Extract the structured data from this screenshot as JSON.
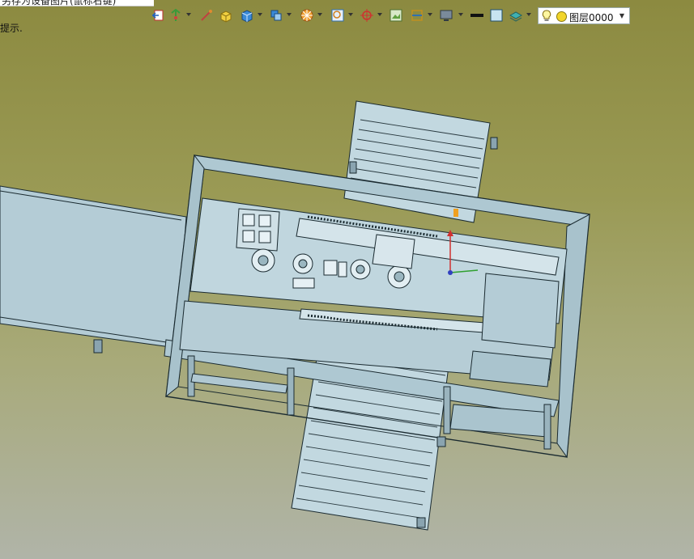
{
  "window": {
    "title_fragment": "另存为设备图片(鼠标右键)"
  },
  "prompt": {
    "text": "提示."
  },
  "toolbar": {
    "icons": [
      "exit-sketch-icon",
      "smart-dimension-icon",
      "line-tool-icon",
      "box-primitive-icon",
      "cube-primitive-icon",
      "solid-view-icon",
      "wheel-icon",
      "zoom-fit-icon",
      "crosshair-icon",
      "image-icon",
      "section-view-icon",
      "monitor-icon",
      "line-style-icon",
      "fill-color-icon",
      "layers-stack-icon"
    ],
    "layer": {
      "name": "图层0000",
      "color": "#f2d52a"
    }
  },
  "colors": {
    "background_top": "#8c8a40",
    "background_bottom": "#b0b4a8",
    "model_fill": "#b8d0da",
    "model_line": "#1a2a30"
  }
}
